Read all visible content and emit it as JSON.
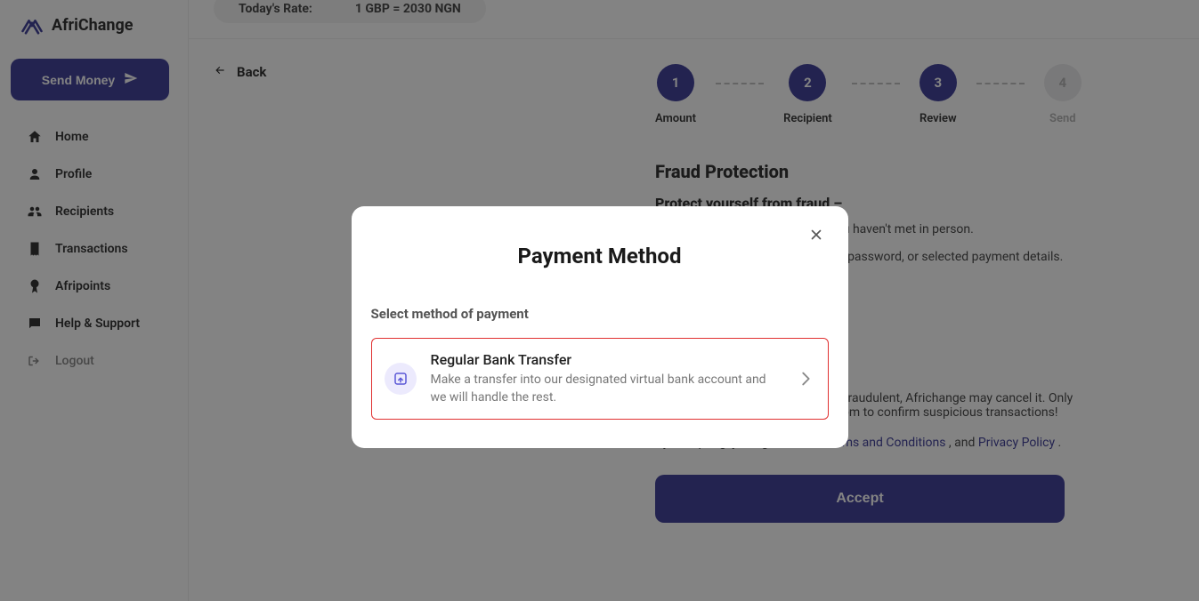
{
  "brand": {
    "name": "AfriChange"
  },
  "sendMoneyLabel": "Send Money",
  "nav": {
    "home": "Home",
    "profile": "Profile",
    "recipients": "Recipients",
    "transactions": "Transactions",
    "afripoints": "Afripoints",
    "help": "Help & Support",
    "logout": "Logout"
  },
  "rate": {
    "label": "Today's Rate:",
    "value": "1 GBP = 2030 NGN"
  },
  "backLabel": "Back",
  "steps": {
    "s1": {
      "num": "1",
      "label": "Amount"
    },
    "s2": {
      "num": "2",
      "label": "Recipient"
    },
    "s3": {
      "num": "3",
      "label": "Review"
    },
    "s4": {
      "num": "4",
      "label": "Send"
    }
  },
  "fraud": {
    "title": "Fraud Protection",
    "subtitle": "Protect yourself from fraud –",
    "line1": "Never send money to someone you haven't met in person.",
    "line2": "Never share your Africhange login, password, or selected payment details.",
    "disclaimer": "If we believe your transfer may be fraudulent, Africhange may cancel it. Only email us at support@africhange.com to confirm suspicious transactions!",
    "agreePrefix": "By accepting, you agree to our ",
    "terms": "Terms and Conditions",
    "and": ", and ",
    "privacy": "Privacy Policy",
    "period": "."
  },
  "acceptLabel": "Accept",
  "modal": {
    "title": "Payment Method",
    "subtitle": "Select method of payment",
    "option": {
      "title": "Regular Bank Transfer",
      "desc": "Make a transfer into our designated virtual bank account and we will handle the rest."
    }
  }
}
